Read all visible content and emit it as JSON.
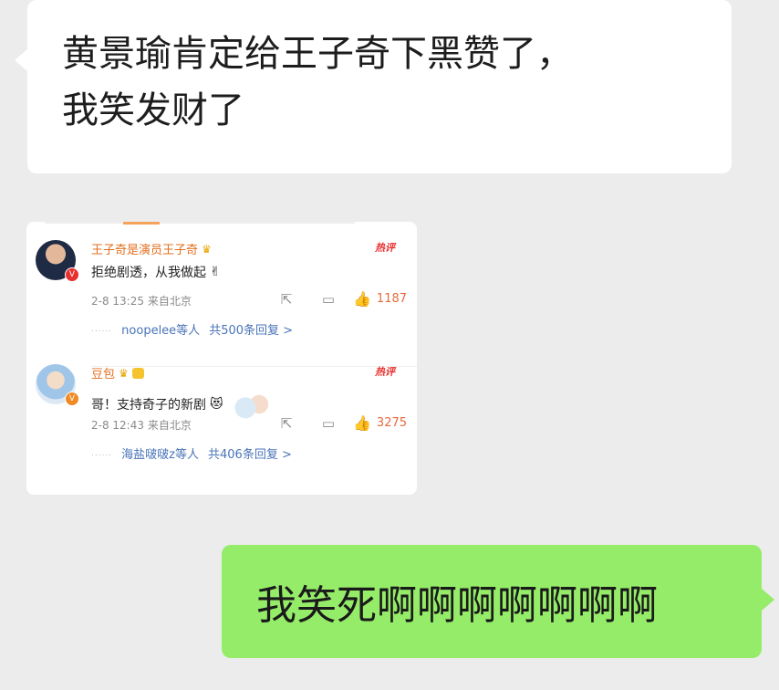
{
  "chat": {
    "incoming_message": "黄景瑜肯定给王子奇下黑赞了，\n我笑发财了",
    "outgoing_message": "我笑死啊啊啊啊啊啊啊"
  },
  "screenshot": {
    "comments": [
      {
        "username": "王子奇是演员王子奇",
        "badge_icon": "crown-icon",
        "hot_label": "热评",
        "text": "拒绝剧透，从我做起",
        "emoji": "✌",
        "time": "2-8 13:25",
        "location": "来自北京",
        "likes": "1187",
        "repliers": "noopelee等人",
        "reply_total": "共500条回复 >"
      },
      {
        "username": "豆包",
        "badge_icon": "crown-icon",
        "hot_label": "热评",
        "text": "哥！支持奇子的新剧",
        "emoji": "😻",
        "time": "2-8 12:43",
        "location": "来自北京",
        "likes": "3275",
        "repliers": "海盐啵啵z等人",
        "reply_total": "共406条回复 >"
      }
    ]
  }
}
